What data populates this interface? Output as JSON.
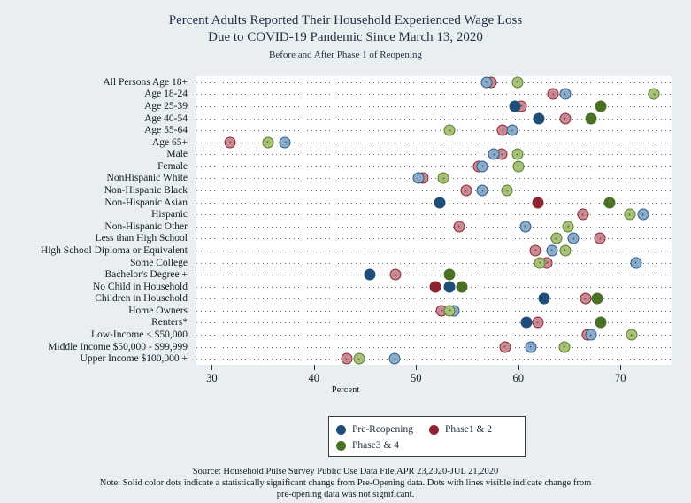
{
  "header": {
    "title_line1": "Percent Adults Reported Their Household Experienced Wage Loss",
    "title_line2": "Due to COVID-19 Pandemic Since March 13, 2020",
    "subtitle": "Before and After Phase 1 of Reopening"
  },
  "legend": {
    "items": [
      {
        "label": "Pre-Reopening",
        "color": "#1f4e79",
        "key": "pre"
      },
      {
        "label": "Phase1 & 2",
        "color": "#8e2433",
        "key": "p12"
      },
      {
        "label": "Phase3 & 4",
        "color": "#4a7024",
        "key": "p34"
      }
    ]
  },
  "notes": {
    "source": "Source: Household Pulse Survey Public Use Data File,APR 23,2020-JUL 21,2020",
    "note_line1": "Note: Solid color dots indicate a statistically significant change from Pre-Opening data. Dots with lines visible indicate change from",
    "note_line2": "pre-opening data was not significant."
  },
  "chart_data": {
    "type": "scatter",
    "title": "Percent Adults Reported Their Household Experienced Wage Loss Due to COVID-19 Pandemic Since March 13, 2020",
    "subtitle": "Before and After Phase 1 of Reopening",
    "xlabel": "Percent",
    "ylabel": "",
    "xlim": [
      28.5,
      75
    ],
    "xticks": [
      30,
      40,
      50,
      60,
      70
    ],
    "xtick_labels": [
      "30",
      "40",
      "50",
      "60",
      "70"
    ],
    "grid": "horizontal-dotted",
    "legend_position": "bottom-center",
    "series_names": [
      "Pre-Reopening",
      "Phase1 & 2",
      "Phase3 & 4"
    ],
    "series_colors": [
      "#1f4e79",
      "#8e2433",
      "#4a7024"
    ],
    "categories": [
      "All Persons Age 18+",
      "Age 18-24",
      "Age 25-39",
      "Age 40-54",
      "Age 55-64",
      "Age 65+",
      "Male",
      "Female",
      "NonHispanic White",
      "Non-Hispanic Black",
      "Non-Hispanic Asian",
      "Hispanic",
      "Non-Hispanic Other",
      "Less than High School",
      "High School Diploma or Equivalent",
      "Some College",
      "Bachelor's Degree +",
      "No Child in Household",
      "Children in Household",
      "Home Owners",
      "Renters*",
      "Low-Income < $50,000",
      "Middle Income $50,000 - $99,999",
      "Upper Income $100,000 +"
    ],
    "points": [
      {
        "category": "All Persons Age 18+",
        "pre": 56.9,
        "p12": 57.3,
        "p34": 59.9,
        "pre_solid": false,
        "p12_solid": false,
        "p34_solid": false
      },
      {
        "category": "Age 18-24",
        "pre": 64.6,
        "p12": 63.4,
        "p34": 73.3,
        "pre_solid": false,
        "p12_solid": false,
        "p34_solid": false
      },
      {
        "category": "Age 25-39",
        "pre": 59.7,
        "p12": 60.3,
        "p34": 68.1,
        "pre_solid": true,
        "p12_solid": false,
        "p34_solid": true
      },
      {
        "category": "Age 40-54",
        "pre": 62.0,
        "p12": 64.6,
        "p34": 67.1,
        "pre_solid": true,
        "p12_solid": false,
        "p34_solid": true
      },
      {
        "category": "Age 55-64",
        "pre": 59.4,
        "p12": 58.5,
        "p34": 53.3,
        "pre_solid": false,
        "p12_solid": false,
        "p34_solid": false
      },
      {
        "category": "Age 65+",
        "pre": 37.2,
        "p12": 31.8,
        "p34": 35.5,
        "pre_solid": false,
        "p12_solid": false,
        "p34_solid": false
      },
      {
        "category": "Male",
        "pre": 57.6,
        "p12": 58.4,
        "p34": 59.9,
        "pre_solid": false,
        "p12_solid": false,
        "p34_solid": false
      },
      {
        "category": "Female",
        "pre": 56.5,
        "p12": 56.1,
        "p34": 60.0,
        "pre_solid": false,
        "p12_solid": false,
        "p34_solid": false
      },
      {
        "category": "NonHispanic White",
        "pre": 50.2,
        "p12": 50.7,
        "p34": 52.7,
        "pre_solid": false,
        "p12_solid": false,
        "p34_solid": false
      },
      {
        "category": "Non-Hispanic Black",
        "pre": 56.5,
        "p12": 54.9,
        "p34": 58.9,
        "pre_solid": false,
        "p12_solid": false,
        "p34_solid": false
      },
      {
        "category": "Non-Hispanic Asian",
        "pre": 52.3,
        "p12": 61.9,
        "p34": 68.9,
        "pre_solid": true,
        "p12_solid": true,
        "p34_solid": true
      },
      {
        "category": "Hispanic",
        "pre": 72.2,
        "p12": 66.3,
        "p34": 70.9,
        "pre_solid": false,
        "p12_solid": false,
        "p34_solid": false
      },
      {
        "category": "Non-Hispanic Other",
        "pre": 60.7,
        "p12": 54.2,
        "p34": 64.9,
        "pre_solid": false,
        "p12_solid": false,
        "p34_solid": false
      },
      {
        "category": "Less than High School",
        "pre": 65.4,
        "p12": 68.0,
        "p34": 63.7,
        "pre_solid": false,
        "p12_solid": false,
        "p34_solid": false
      },
      {
        "category": "High School Diploma or Equivalent",
        "pre": 63.3,
        "p12": 61.7,
        "p34": 64.6,
        "pre_solid": false,
        "p12_solid": false,
        "p34_solid": false
      },
      {
        "category": "Some College",
        "pre": 71.5,
        "p12": 62.8,
        "p34": 62.1,
        "pre_solid": false,
        "p12_solid": false,
        "p34_solid": false
      },
      {
        "category": "Bachelor's Degree +",
        "pre": 45.5,
        "p12": 48.0,
        "p34": 53.3,
        "pre_solid": true,
        "p12_solid": false,
        "p34_solid": true
      },
      {
        "category": "No Child in Household",
        "pre": 53.3,
        "p12": 51.9,
        "p34": 54.5,
        "pre_solid": true,
        "p12_solid": true,
        "p34_solid": true
      },
      {
        "category": "Children in Household",
        "pre": 62.5,
        "p12": 66.6,
        "p34": 67.7,
        "pre_solid": true,
        "p12_solid": false,
        "p34_solid": true
      },
      {
        "category": "Home Owners",
        "pre": 53.7,
        "p12": 52.5,
        "p34": 53.3,
        "pre_solid": false,
        "p12_solid": false,
        "p34_solid": false
      },
      {
        "category": "Renters*",
        "pre": 60.8,
        "p12": 61.9,
        "p34": 68.1,
        "pre_solid": true,
        "p12_solid": false,
        "p34_solid": true
      },
      {
        "category": "Low-Income < $50,000",
        "pre": 67.1,
        "p12": 66.8,
        "p34": 71.1,
        "pre_solid": false,
        "p12_solid": false,
        "p34_solid": false
      },
      {
        "category": "Middle Income $50,000 - $99,999",
        "pre": 61.2,
        "p12": 58.7,
        "p34": 64.5,
        "pre_solid": false,
        "p12_solid": false,
        "p34_solid": false
      },
      {
        "category": "Upper Income $100,000 +",
        "pre": 47.9,
        "p12": 43.2,
        "p34": 44.4,
        "pre_solid": false,
        "p12_solid": false,
        "p34_solid": false
      }
    ]
  }
}
